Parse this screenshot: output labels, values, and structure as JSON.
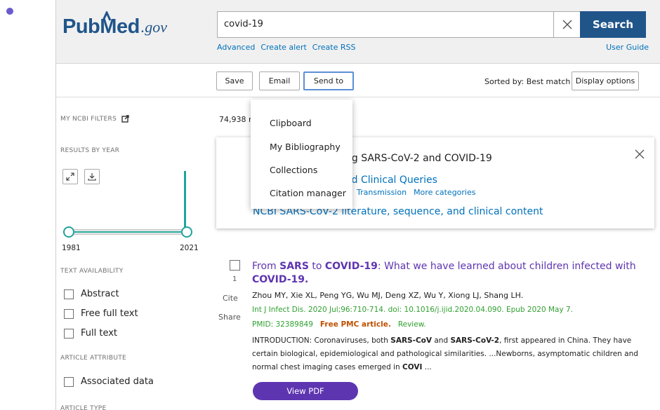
{
  "header": {
    "logo": {
      "pub": "Pub",
      "med": "Med",
      "gov": ".gov"
    },
    "search": {
      "value": "covid-19",
      "button": "Search"
    },
    "links": [
      "Advanced",
      "Create alert",
      "Create RSS"
    ],
    "user_guide": "User Guide"
  },
  "toolbar": {
    "save": "Save",
    "email": "Email",
    "send_to": "Send to",
    "sorted_by": "Sorted by: Best match",
    "display_options": "Display options"
  },
  "send_to_menu": [
    "Clipboard",
    "My Bibliography",
    "Collections",
    "Citation manager"
  ],
  "sidebar": {
    "my_ncbi_filters": "MY NCBI FILTERS",
    "results_by_year": "RESULTS BY YEAR",
    "year_start": "1981",
    "year_end": "2021",
    "text_availability": "TEXT AVAILABILITY",
    "text_filters": [
      "Abstract",
      "Free full text",
      "Full text"
    ],
    "article_attribute": "ARTICLE ATTRIBUTE",
    "attribute_filters": [
      "Associated data"
    ],
    "article_type": "ARTICLE TYPE"
  },
  "results_count": "74,938 re",
  "card": {
    "title": "ng SARS-CoV-2 and COVID-19",
    "link_main": "ed Clinical Queries",
    "links": [
      "Transmission",
      "More categories"
    ],
    "ncbi_link": "NCBI SARS-CoV-2 literature, sequence, and clinical content"
  },
  "result": {
    "index": "1",
    "cite": "Cite",
    "share": "Share",
    "title_parts": [
      "From ",
      "SARS",
      " to ",
      "COVID-19",
      ": What we have learned about children infected with ",
      "COVID-19",
      "."
    ],
    "authors": "Zhou MY, Xie XL, Peng YG, Wu MJ, Deng XZ, Wu Y, Xiong LJ, Shang LH.",
    "journal": "Int J Infect Dis. 2020 Jul;96:710-714. doi: 10.1016/j.ijid.2020.04.090. Epub 2020 May 7.",
    "pmid": "PMID: 32389849",
    "free_pmc": "Free PMC article.",
    "review": "Review.",
    "snippet_parts": [
      "INTRODUCTION: Coronaviruses, both ",
      "SARS-CoV",
      " and ",
      "SARS-CoV-2",
      ", first appeared in China. They have certain biological, epidemiological and pathological similarities. ...Newborns, asymptomatic children and normal chest imaging cases emerged in ",
      "COVI",
      " ..."
    ],
    "view_pdf": "View PDF"
  },
  "colors": {
    "brand": "#20558a",
    "link": "#0071bc",
    "title_purple": "#5e35b1",
    "teal_bar": "#20a59a",
    "journal_green": "#30a030",
    "free_pmc": "#c05000"
  }
}
